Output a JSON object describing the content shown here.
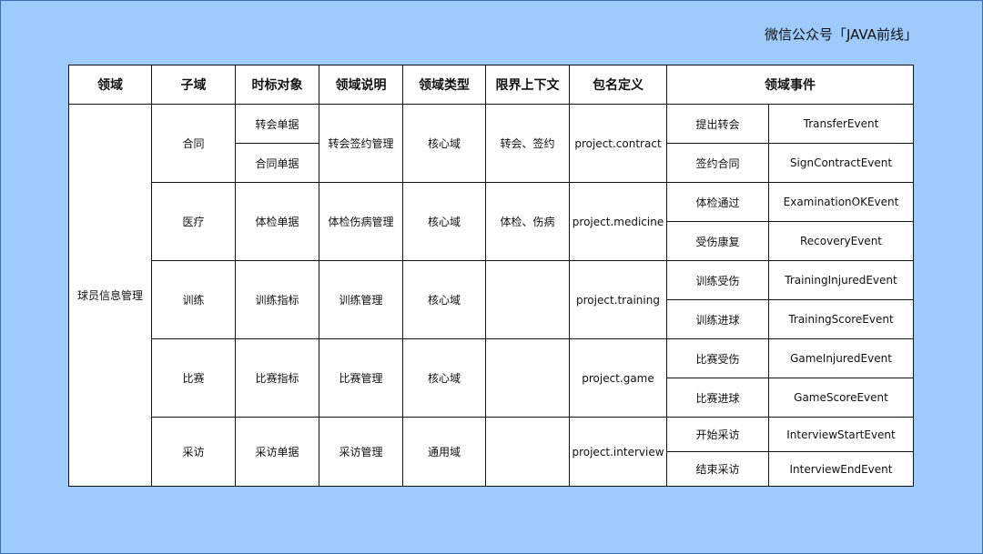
{
  "watermark": "微信公众号「JAVA前线」",
  "headers": [
    "领域",
    "子域",
    "时标对象",
    "领域说明",
    "领域类型",
    "限界上下文",
    "包名定义",
    "领域事件"
  ],
  "domain": "球员信息管理",
  "subdomains": [
    {
      "name": "合同",
      "objects": [
        "转会单据",
        "合同单据"
      ],
      "description": "转会签约管理",
      "type": "核心域",
      "context": "转会、签约",
      "package": "project.contract",
      "events": [
        {
          "cn": "提出转会",
          "en": "TransferEvent"
        },
        {
          "cn": "签约合同",
          "en": "SignContractEvent"
        }
      ]
    },
    {
      "name": "医疗",
      "objects": [
        "体检单据"
      ],
      "description": "体检伤病管理",
      "type": "核心域",
      "context": "体检、伤病",
      "package": "project.medicine",
      "events": [
        {
          "cn": "体检通过",
          "en": "ExaminationOKEvent"
        },
        {
          "cn": "受伤康复",
          "en": "RecoveryEvent"
        }
      ]
    },
    {
      "name": "训练",
      "objects": [
        "训练指标"
      ],
      "description": "训练管理",
      "type": "核心域",
      "context": "",
      "package": "project.training",
      "events": [
        {
          "cn": "训练受伤",
          "en": "TrainingInjuredEvent"
        },
        {
          "cn": "训练进球",
          "en": "TrainingScoreEvent"
        }
      ]
    },
    {
      "name": "比赛",
      "objects": [
        "比赛指标"
      ],
      "description": "比赛管理",
      "type": "核心域",
      "context": "",
      "package": "project.game",
      "events": [
        {
          "cn": "比赛受伤",
          "en": "GameInjuredEvent"
        },
        {
          "cn": "比赛进球",
          "en": "GameScoreEvent"
        }
      ]
    },
    {
      "name": "采访",
      "objects": [
        "采访单据"
      ],
      "description": "采访管理",
      "type": "通用域",
      "context": "",
      "package": "project.interview",
      "events": [
        {
          "cn": "开始采访",
          "en": "InterviewStartEvent"
        },
        {
          "cn": "结束采访",
          "en": "InterviewEndEvent"
        }
      ]
    }
  ]
}
